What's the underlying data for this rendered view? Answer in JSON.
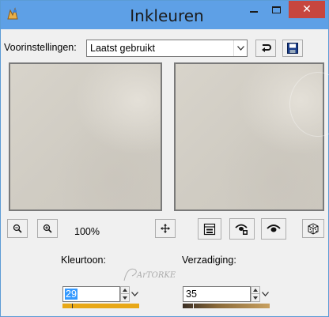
{
  "window": {
    "title": "Inkleuren",
    "close_glyph": "✕"
  },
  "presets": {
    "label": "Voorinstellingen:",
    "selected": "Laatst gebruikt"
  },
  "zoom": {
    "level": "100%"
  },
  "hue": {
    "label": "Kleurtoon:",
    "value": "29"
  },
  "saturation": {
    "label": "Verzadiging:",
    "value": "35"
  },
  "icons": {
    "app": "app-icon",
    "reset": "reset-icon",
    "save": "save-icon",
    "zoom_out": "zoom-out-icon",
    "zoom_in": "zoom-in-icon",
    "pan": "pan-icon",
    "dice": "dice-icon"
  },
  "colors": {
    "titlebar": "#5ea0e6",
    "close": "#c7463e",
    "hue_bar": "#e8a818",
    "selection": "#3399ff"
  }
}
